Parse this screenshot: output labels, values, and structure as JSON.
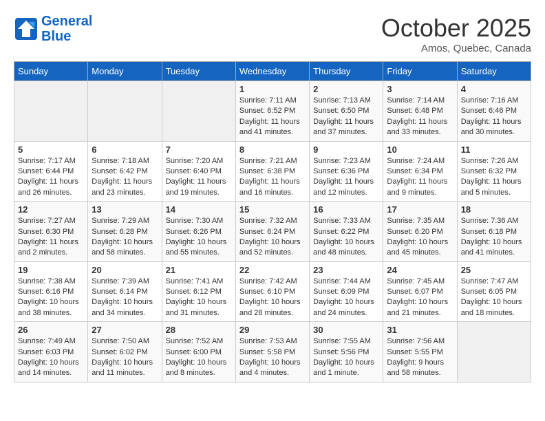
{
  "header": {
    "logo_line1": "General",
    "logo_line2": "Blue",
    "month": "October 2025",
    "location": "Amos, Quebec, Canada"
  },
  "days_of_week": [
    "Sunday",
    "Monday",
    "Tuesday",
    "Wednesday",
    "Thursday",
    "Friday",
    "Saturday"
  ],
  "weeks": [
    [
      {
        "day": "",
        "info": ""
      },
      {
        "day": "",
        "info": ""
      },
      {
        "day": "",
        "info": ""
      },
      {
        "day": "1",
        "info": "Sunrise: 7:11 AM\nSunset: 6:52 PM\nDaylight: 11 hours\nand 41 minutes."
      },
      {
        "day": "2",
        "info": "Sunrise: 7:13 AM\nSunset: 6:50 PM\nDaylight: 11 hours\nand 37 minutes."
      },
      {
        "day": "3",
        "info": "Sunrise: 7:14 AM\nSunset: 6:48 PM\nDaylight: 11 hours\nand 33 minutes."
      },
      {
        "day": "4",
        "info": "Sunrise: 7:16 AM\nSunset: 6:46 PM\nDaylight: 11 hours\nand 30 minutes."
      }
    ],
    [
      {
        "day": "5",
        "info": "Sunrise: 7:17 AM\nSunset: 6:44 PM\nDaylight: 11 hours\nand 26 minutes."
      },
      {
        "day": "6",
        "info": "Sunrise: 7:18 AM\nSunset: 6:42 PM\nDaylight: 11 hours\nand 23 minutes."
      },
      {
        "day": "7",
        "info": "Sunrise: 7:20 AM\nSunset: 6:40 PM\nDaylight: 11 hours\nand 19 minutes."
      },
      {
        "day": "8",
        "info": "Sunrise: 7:21 AM\nSunset: 6:38 PM\nDaylight: 11 hours\nand 16 minutes."
      },
      {
        "day": "9",
        "info": "Sunrise: 7:23 AM\nSunset: 6:36 PM\nDaylight: 11 hours\nand 12 minutes."
      },
      {
        "day": "10",
        "info": "Sunrise: 7:24 AM\nSunset: 6:34 PM\nDaylight: 11 hours\nand 9 minutes."
      },
      {
        "day": "11",
        "info": "Sunrise: 7:26 AM\nSunset: 6:32 PM\nDaylight: 11 hours\nand 5 minutes."
      }
    ],
    [
      {
        "day": "12",
        "info": "Sunrise: 7:27 AM\nSunset: 6:30 PM\nDaylight: 11 hours\nand 2 minutes."
      },
      {
        "day": "13",
        "info": "Sunrise: 7:29 AM\nSunset: 6:28 PM\nDaylight: 10 hours\nand 58 minutes."
      },
      {
        "day": "14",
        "info": "Sunrise: 7:30 AM\nSunset: 6:26 PM\nDaylight: 10 hours\nand 55 minutes."
      },
      {
        "day": "15",
        "info": "Sunrise: 7:32 AM\nSunset: 6:24 PM\nDaylight: 10 hours\nand 52 minutes."
      },
      {
        "day": "16",
        "info": "Sunrise: 7:33 AM\nSunset: 6:22 PM\nDaylight: 10 hours\nand 48 minutes."
      },
      {
        "day": "17",
        "info": "Sunrise: 7:35 AM\nSunset: 6:20 PM\nDaylight: 10 hours\nand 45 minutes."
      },
      {
        "day": "18",
        "info": "Sunrise: 7:36 AM\nSunset: 6:18 PM\nDaylight: 10 hours\nand 41 minutes."
      }
    ],
    [
      {
        "day": "19",
        "info": "Sunrise: 7:38 AM\nSunset: 6:16 PM\nDaylight: 10 hours\nand 38 minutes."
      },
      {
        "day": "20",
        "info": "Sunrise: 7:39 AM\nSunset: 6:14 PM\nDaylight: 10 hours\nand 34 minutes."
      },
      {
        "day": "21",
        "info": "Sunrise: 7:41 AM\nSunset: 6:12 PM\nDaylight: 10 hours\nand 31 minutes."
      },
      {
        "day": "22",
        "info": "Sunrise: 7:42 AM\nSunset: 6:10 PM\nDaylight: 10 hours\nand 28 minutes."
      },
      {
        "day": "23",
        "info": "Sunrise: 7:44 AM\nSunset: 6:09 PM\nDaylight: 10 hours\nand 24 minutes."
      },
      {
        "day": "24",
        "info": "Sunrise: 7:45 AM\nSunset: 6:07 PM\nDaylight: 10 hours\nand 21 minutes."
      },
      {
        "day": "25",
        "info": "Sunrise: 7:47 AM\nSunset: 6:05 PM\nDaylight: 10 hours\nand 18 minutes."
      }
    ],
    [
      {
        "day": "26",
        "info": "Sunrise: 7:49 AM\nSunset: 6:03 PM\nDaylight: 10 hours\nand 14 minutes."
      },
      {
        "day": "27",
        "info": "Sunrise: 7:50 AM\nSunset: 6:02 PM\nDaylight: 10 hours\nand 11 minutes."
      },
      {
        "day": "28",
        "info": "Sunrise: 7:52 AM\nSunset: 6:00 PM\nDaylight: 10 hours\nand 8 minutes."
      },
      {
        "day": "29",
        "info": "Sunrise: 7:53 AM\nSunset: 5:58 PM\nDaylight: 10 hours\nand 4 minutes."
      },
      {
        "day": "30",
        "info": "Sunrise: 7:55 AM\nSunset: 5:56 PM\nDaylight: 10 hours\nand 1 minute."
      },
      {
        "day": "31",
        "info": "Sunrise: 7:56 AM\nSunset: 5:55 PM\nDaylight: 9 hours\nand 58 minutes."
      },
      {
        "day": "",
        "info": ""
      }
    ]
  ]
}
